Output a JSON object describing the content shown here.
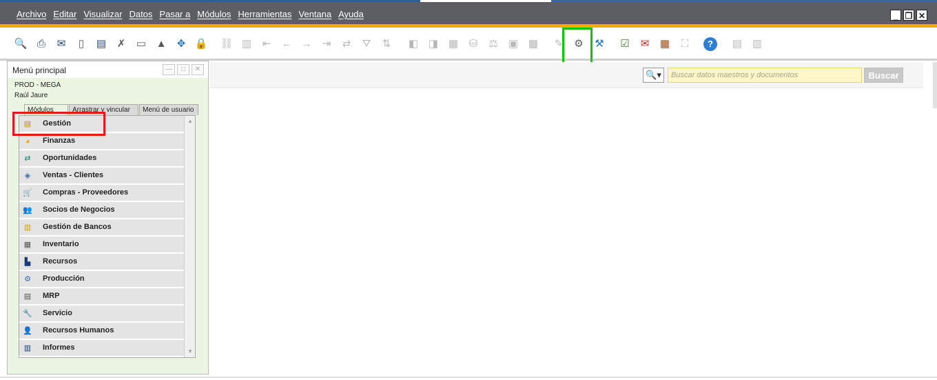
{
  "menubar": {
    "items": [
      "Archivo",
      "Editar",
      "Visualizar",
      "Datos",
      "Pasar a",
      "Módulos",
      "Herramientas",
      "Ventana",
      "Ayuda"
    ],
    "window_controls": {
      "minimize": "_",
      "restore": "❐",
      "close": "✕"
    }
  },
  "toolbar": {
    "icons": [
      "print-preview-icon",
      "print-icon",
      "email-icon",
      "sms-icon",
      "fax-icon",
      "export-excel-icon",
      "export-word-icon",
      "export-pdf-icon",
      "launch-app-icon",
      "lock-screen-icon",
      "find-icon",
      "add-icon",
      "first-record-icon",
      "previous-record-icon",
      "next-record-icon",
      "last-record-icon",
      "refresh-icon",
      "filter-icon",
      "sort-icon",
      "base-document-icon",
      "target-document-icon",
      "relationship-map-icon",
      "payment-means-icon",
      "volume-weight-icon",
      "gross-profit-icon",
      "drill-down-icon",
      "layout-designer-icon",
      "document-settings-icon",
      "form-settings-icon",
      "calendar-icon",
      "messages-icon",
      "alerts-icon",
      "organization-icon",
      "help-icon",
      "query-icon",
      "query-wizard-icon"
    ]
  },
  "search": {
    "placeholder": "Buscar datos maestros y documentos",
    "button_label": "Buscar",
    "button_icon": "search-icon"
  },
  "main_menu": {
    "title": "Menú principal",
    "company": "PROD - MEGA",
    "user": "Raúl Jaure",
    "tabs": [
      "Módulos",
      "Arrastrar y vincular",
      "Menú de usuario"
    ],
    "modules": [
      {
        "label": "Gestión",
        "icon": "administration-icon"
      },
      {
        "label": "Finanzas",
        "icon": "financials-icon"
      },
      {
        "label": "Oportunidades",
        "icon": "opportunities-icon"
      },
      {
        "label": "Ventas - Clientes",
        "icon": "sales-icon"
      },
      {
        "label": "Compras - Proveedores",
        "icon": "purchasing-icon"
      },
      {
        "label": "Socios de Negocios",
        "icon": "business-partners-icon"
      },
      {
        "label": "Gestión de Bancos",
        "icon": "banking-icon"
      },
      {
        "label": "Inventario",
        "icon": "inventory-icon"
      },
      {
        "label": "Recursos",
        "icon": "resources-icon"
      },
      {
        "label": "Producción",
        "icon": "production-icon"
      },
      {
        "label": "MRP",
        "icon": "mrp-icon"
      },
      {
        "label": "Servicio",
        "icon": "service-icon"
      },
      {
        "label": "Recursos Humanos",
        "icon": "human-resources-icon"
      },
      {
        "label": "Informes",
        "icon": "reports-icon"
      }
    ]
  },
  "highlight_colors": {
    "red_box": "#e21a1a",
    "green_box": "#16c20c",
    "accent_bar": "#f0ab00"
  }
}
